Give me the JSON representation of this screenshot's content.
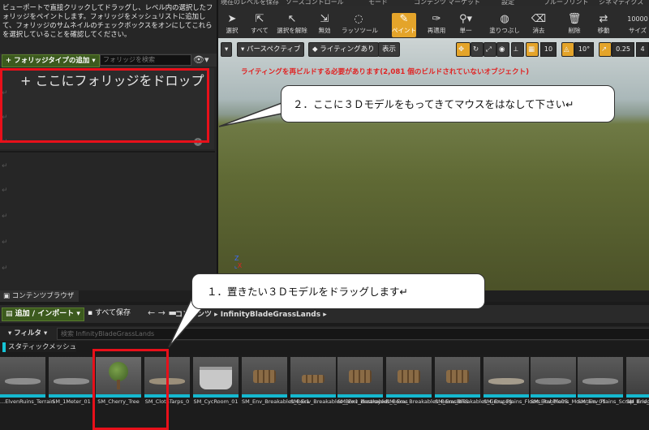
{
  "top_menu": [
    "現在のレベルを保存",
    "ソースコントロール",
    "モード",
    "コンテンツ",
    "マーケット",
    "設定",
    "ブループリント",
    "シネマティクス"
  ],
  "left_panel": {
    "description": "ビューポートで直接クリックしてドラッグし、レベル内の選択したフォリッジをペイントします。フォリッジをメッシュリストに追加して、フォリッジのサムネイルのチェックボックスをオンにしてこれらを選択していることを確認してください。",
    "add_foliage_label": "+ フォリッジタイプの追加 ▾",
    "search_placeholder": "フォリッジを検索",
    "dropzone_text": "+ ここにフォリッジをドロップ"
  },
  "toolbar": {
    "tools": [
      {
        "label": "選択",
        "icon": "cursor-icon"
      },
      {
        "label": "すべて",
        "icon": "cursor-all-icon"
      },
      {
        "label": "選択を解除",
        "icon": "deselect-icon"
      },
      {
        "label": "無効",
        "icon": "invalid-icon"
      },
      {
        "label": "ラッソツール",
        "icon": "lasso-icon"
      },
      {
        "label": "ペイント",
        "icon": "paint-brush-icon"
      },
      {
        "label": "再適用",
        "icon": "reapply-icon"
      },
      {
        "label": "単一",
        "icon": "single-icon"
      },
      {
        "label": "塗りつぶし",
        "icon": "fill-icon"
      },
      {
        "label": "消去",
        "icon": "erase-icon"
      },
      {
        "label": "削除",
        "icon": "trash-icon"
      },
      {
        "label": "移動",
        "icon": "move-icon"
      },
      {
        "label": "サイズ",
        "icon": "size-icon"
      }
    ],
    "size_value": "10000"
  },
  "viewport": {
    "menu_label": "▾",
    "perspective_label": "パースペクティブ",
    "lighting_label": "ライティングあり",
    "show_label": "表示",
    "grid_value": "10",
    "angle_value": "10°",
    "scale_value": "0.25",
    "cam_value": "4",
    "warning": "ライティングを再ビルドする必要があります(2,081 個のビルドされていないオブジェクト)",
    "axis_label": "Z  X"
  },
  "callouts": {
    "step2": "２．ここに３Ｄモデルをもってきてマウスをはなして下さい↵",
    "step1": "１．置きたい３Ｄモデルをドラッグします↵"
  },
  "content_browser": {
    "tab_label": "コンテンツブラウザ",
    "add_import_label": "追加 / インポート ▾",
    "save_all_label": "すべて保存",
    "breadcrumb": "コンテンツ ▸ InfinityBladeGrassLands ▸",
    "filter_label": "▾ フィルタ ▾",
    "search_placeholder": "検索 InfinityBladeGrassLands",
    "static_mesh_label": "スタティックメッシュ",
    "assets": [
      {
        "name": "...ElvenRuins_Terrain",
        "thumb": "flat"
      },
      {
        "name": "SM_1Meter_01",
        "thumb": "flat"
      },
      {
        "name": "SM_Cherry_Tree",
        "thumb": "tree"
      },
      {
        "name": "SM_ClothTarps_0",
        "thumb": "flat"
      },
      {
        "name": "SM_CycRoom_01",
        "thumb": "cyc"
      },
      {
        "name": "SM_Env_Breakables_Box1",
        "thumb": "pile"
      },
      {
        "name": "SM_Env_Breakables_Box1_destroyed",
        "thumb": "pile"
      },
      {
        "name": "SM_Env_Breakables_Boxes",
        "thumb": "pile"
      },
      {
        "name": "SM_Env_Breakables_BoxesBITS",
        "thumb": "pile"
      },
      {
        "name": "SM_Env_Breakables_GroupLg",
        "thumb": "pile"
      },
      {
        "name": "SM_Env_Plains_Floors_Rubble05",
        "thumb": "flat"
      },
      {
        "name": "SM_Env_Plains_Mountain_01",
        "thumb": "flat"
      },
      {
        "name": "SM_Env_Plains_Scrap_Bridge_2",
        "thumb": "flat"
      },
      {
        "name": "SM_Env_...",
        "thumb": "flat"
      }
    ]
  },
  "colors": {
    "highlight_red": "#e8101a",
    "paint_orange": "#e4a42a",
    "asset_cyan": "#15b8cf",
    "warning_red": "#e02222"
  }
}
